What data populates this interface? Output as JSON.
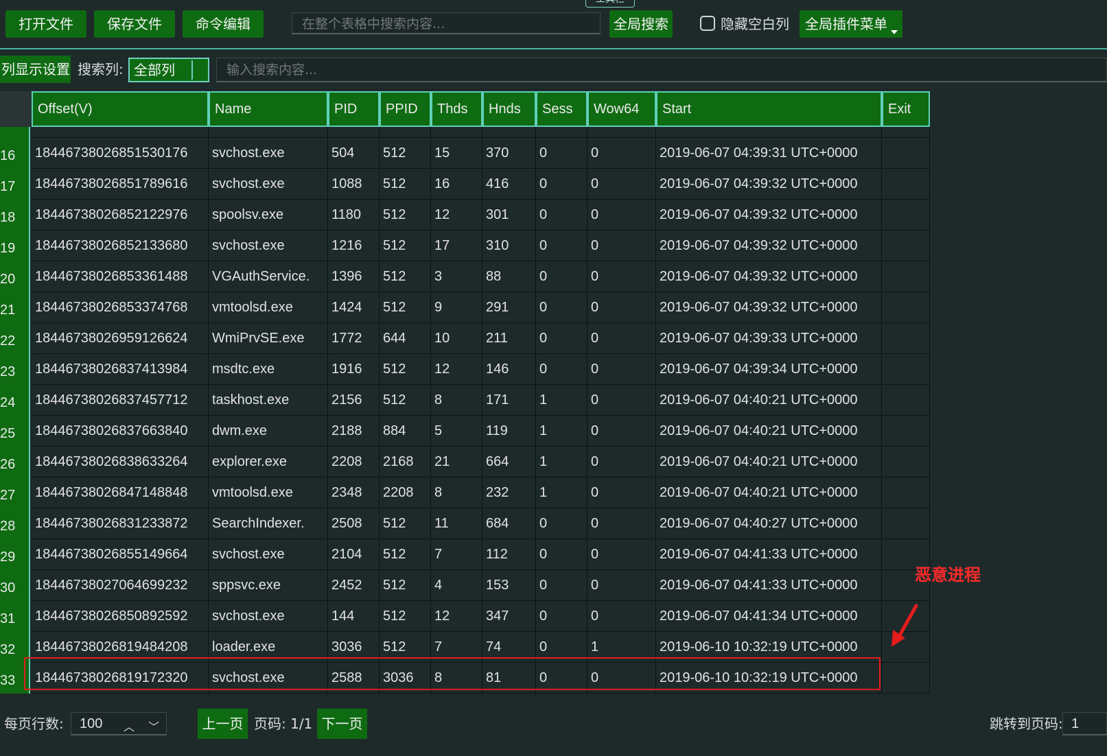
{
  "toolbar": {
    "tab_label": "工具栏",
    "open_file": "打开文件",
    "save_file": "保存文件",
    "command_edit": "命令编辑",
    "global_search_placeholder": "在整个表格中搜索内容...",
    "global_search_button": "全局搜索",
    "hide_empty_columns": "隐藏空白列",
    "plugin_menu": "全局插件菜单"
  },
  "filter_bar": {
    "column_settings": "列显示设置",
    "search_column_label": "搜索列:",
    "search_column_value": "全部列",
    "search_placeholder": "输入搜索内容..."
  },
  "table": {
    "columns": [
      "Offset(V)",
      "Name",
      "PID",
      "PPID",
      "Thds",
      "Hnds",
      "Sess",
      "Wow64",
      "Start",
      "Exit"
    ],
    "rows": [
      {
        "num": "16",
        "cells": [
          "18446738026851530176",
          "svchost.exe",
          "504",
          "512",
          "15",
          "370",
          "0",
          "0",
          "2019-06-07 04:39:31 UTC+0000",
          ""
        ]
      },
      {
        "num": "17",
        "cells": [
          "18446738026851789616",
          "svchost.exe",
          "1088",
          "512",
          "16",
          "416",
          "0",
          "0",
          "2019-06-07 04:39:32 UTC+0000",
          ""
        ]
      },
      {
        "num": "18",
        "cells": [
          "18446738026852122976",
          "spoolsv.exe",
          "1180",
          "512",
          "12",
          "301",
          "0",
          "0",
          "2019-06-07 04:39:32 UTC+0000",
          ""
        ]
      },
      {
        "num": "19",
        "cells": [
          "18446738026852133680",
          "svchost.exe",
          "1216",
          "512",
          "17",
          "310",
          "0",
          "0",
          "2019-06-07 04:39:32 UTC+0000",
          ""
        ]
      },
      {
        "num": "20",
        "cells": [
          "18446738026853361488",
          "VGAuthService.",
          "1396",
          "512",
          "3",
          "88",
          "0",
          "0",
          "2019-06-07 04:39:32 UTC+0000",
          ""
        ]
      },
      {
        "num": "21",
        "cells": [
          "18446738026853374768",
          "vmtoolsd.exe",
          "1424",
          "512",
          "9",
          "291",
          "0",
          "0",
          "2019-06-07 04:39:32 UTC+0000",
          ""
        ]
      },
      {
        "num": "22",
        "cells": [
          "18446738026959126624",
          "WmiPrvSE.exe",
          "1772",
          "644",
          "10",
          "211",
          "0",
          "0",
          "2019-06-07 04:39:33 UTC+0000",
          ""
        ]
      },
      {
        "num": "23",
        "cells": [
          "18446738026837413984",
          "msdtc.exe",
          "1916",
          "512",
          "12",
          "146",
          "0",
          "0",
          "2019-06-07 04:39:34 UTC+0000",
          ""
        ]
      },
      {
        "num": "24",
        "cells": [
          "18446738026837457712",
          "taskhost.exe",
          "2156",
          "512",
          "8",
          "171",
          "1",
          "0",
          "2019-06-07 04:40:21 UTC+0000",
          ""
        ]
      },
      {
        "num": "25",
        "cells": [
          "18446738026837663840",
          "dwm.exe",
          "2188",
          "884",
          "5",
          "119",
          "1",
          "0",
          "2019-06-07 04:40:21 UTC+0000",
          ""
        ]
      },
      {
        "num": "26",
        "cells": [
          "18446738026838633264",
          "explorer.exe",
          "2208",
          "2168",
          "21",
          "664",
          "1",
          "0",
          "2019-06-07 04:40:21 UTC+0000",
          ""
        ]
      },
      {
        "num": "27",
        "cells": [
          "18446738026847148848",
          "vmtoolsd.exe",
          "2348",
          "2208",
          "8",
          "232",
          "1",
          "0",
          "2019-06-07 04:40:21 UTC+0000",
          ""
        ]
      },
      {
        "num": "28",
        "cells": [
          "18446738026831233872",
          "SearchIndexer.",
          "2508",
          "512",
          "11",
          "684",
          "0",
          "0",
          "2019-06-07 04:40:27 UTC+0000",
          ""
        ]
      },
      {
        "num": "29",
        "cells": [
          "18446738026855149664",
          "svchost.exe",
          "2104",
          "512",
          "7",
          "112",
          "0",
          "0",
          "2019-06-07 04:41:33 UTC+0000",
          ""
        ]
      },
      {
        "num": "30",
        "cells": [
          "18446738027064699232",
          "sppsvc.exe",
          "2452",
          "512",
          "4",
          "153",
          "0",
          "0",
          "2019-06-07 04:41:33 UTC+0000",
          ""
        ]
      },
      {
        "num": "31",
        "cells": [
          "18446738026850892592",
          "svchost.exe",
          "144",
          "512",
          "12",
          "347",
          "0",
          "0",
          "2019-06-07 04:41:34 UTC+0000",
          ""
        ]
      },
      {
        "num": "32",
        "cells": [
          "18446738026819484208",
          "loader.exe",
          "3036",
          "512",
          "7",
          "74",
          "0",
          "1",
          "2019-06-10 10:32:19 UTC+0000",
          ""
        ]
      },
      {
        "num": "33",
        "cells": [
          "18446738026819172320",
          "svchost.exe",
          "2588",
          "3036",
          "8",
          "81",
          "0",
          "0",
          "2019-06-10 10:32:19 UTC+0000",
          ""
        ]
      }
    ]
  },
  "annotation": {
    "label": "恶意进程",
    "color": "#e41c1c"
  },
  "footer": {
    "rows_per_page_label": "每页行数:",
    "rows_per_page_value": "100",
    "prev_page": "上一页",
    "page_info": "页码: 1/1",
    "next_page": "下一页",
    "goto_page_label": "跳转到页码:",
    "goto_page_value": "1"
  },
  "colors": {
    "background": "#1e2a2a",
    "button_green": "#0f6b12",
    "accent_teal": "#5fd0b8"
  }
}
